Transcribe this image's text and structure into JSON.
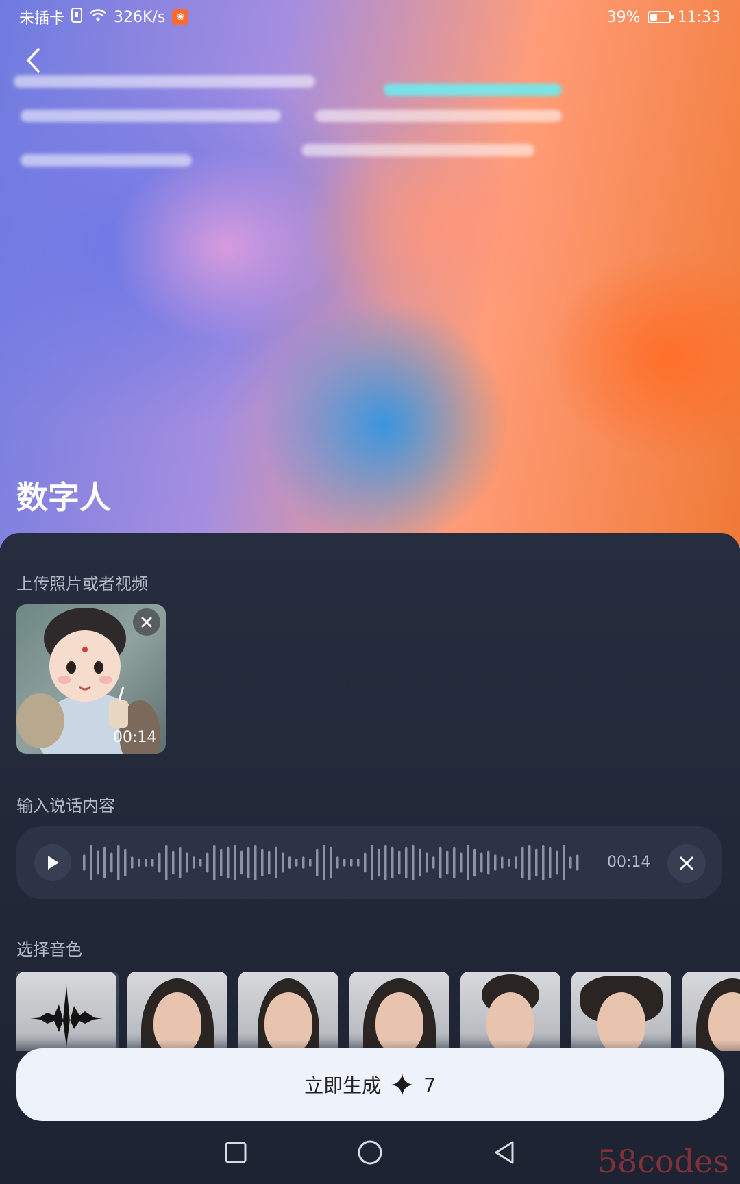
{
  "status_bar": {
    "carrier": "未插卡",
    "speed": "326K/s",
    "battery": "39%",
    "battery_level": 0.39,
    "time": "11:33"
  },
  "header": {
    "title": "数字人",
    "back_icon": "chevron-left-icon"
  },
  "upload": {
    "label": "上传照片或者视频",
    "thumbnail_duration": "00:14",
    "close_icon": "close-icon"
  },
  "speech": {
    "label": "输入说话内容",
    "audio_duration": "00:14",
    "play_icon": "play-icon",
    "close_icon": "close-icon"
  },
  "voice": {
    "label": "选择音色",
    "options": [
      {
        "type": "waveform",
        "selected": true
      },
      {
        "type": "portrait"
      },
      {
        "type": "portrait"
      },
      {
        "type": "portrait"
      },
      {
        "type": "portrait"
      },
      {
        "type": "portrait"
      },
      {
        "type": "portrait"
      }
    ]
  },
  "generate": {
    "label": "立即生成",
    "cost": "7",
    "icon": "sparkle-icon"
  },
  "watermark": "58codes",
  "colors": {
    "panel_bg": "#1e2433",
    "audio_bar_bg": "#2c3345",
    "button_bg": "#eef3fb"
  }
}
